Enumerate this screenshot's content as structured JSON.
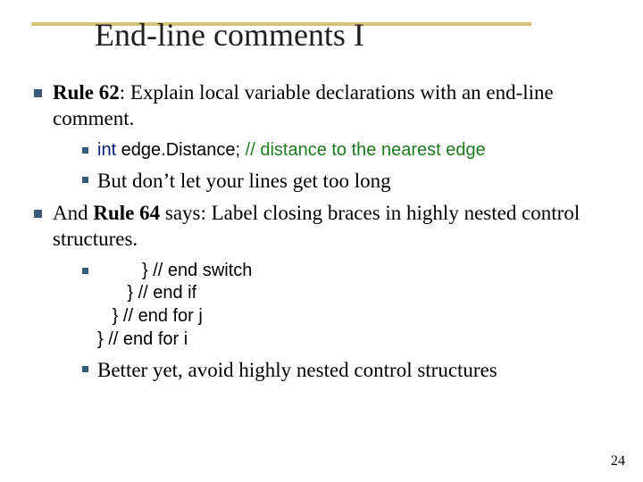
{
  "title": "End-line comments I",
  "points": {
    "rule62_run1": "Rule 62",
    "rule62_run2": ": Explain local variable declarations with an end-line comment.",
    "code_kw": "int",
    "code_rest": " edge.Distance; ",
    "code_cmt": "// distance to the nearest edge",
    "rule62_sub2": "But don’t let your lines get too long",
    "rule64_run1": "And ",
    "rule64_run2": "Rule 64",
    "rule64_run3": " says: Label closing braces in highly nested control structures.",
    "rule64_sub2": "Better yet, avoid highly nested control structures"
  },
  "codeblock": {
    "l1": "         } // end switch",
    "l2": "      } // end if",
    "l3": "   } // end for j",
    "l4": "} // end for i"
  },
  "pagenum": "24"
}
